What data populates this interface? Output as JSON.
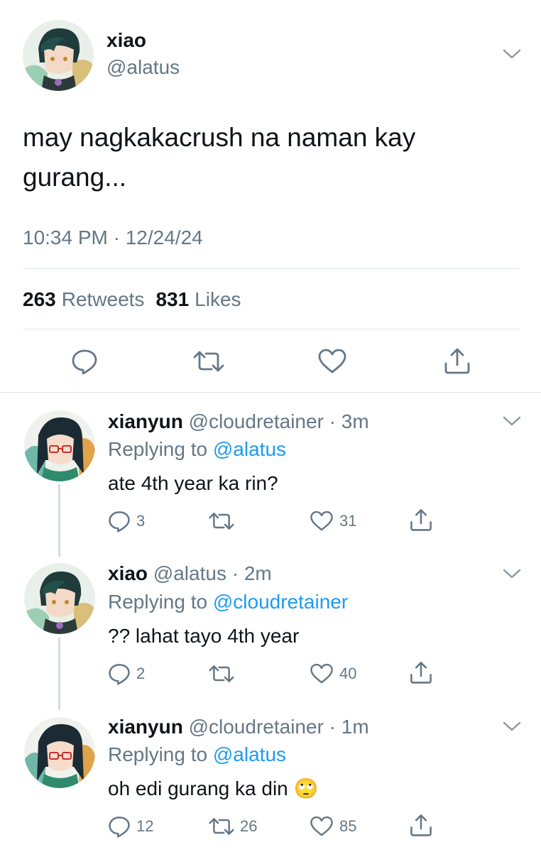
{
  "main_tweet": {
    "display_name": "xiao",
    "handle": "@alatus",
    "text_line1": "may nagkakacrush na naman kay",
    "text_line2": "gurang...",
    "timestamp": "10:34 PM · 12/24/24",
    "retweets_count": "263",
    "retweets_label": "Retweets",
    "likes_count": "831",
    "likes_label": "Likes",
    "menu_icon": "chevron-down-icon",
    "actions": [
      "reply-icon",
      "retweet-icon",
      "like-icon",
      "share-icon"
    ]
  },
  "replies": [
    {
      "display_name": "xianyun",
      "handle_time": "@cloudretainer · 3m",
      "replying_prefix": "Replying to",
      "replying_to": "@alatus",
      "text": "ate 4th year ka rin?",
      "reply_count": "3",
      "retweet_count": "",
      "like_count": "31"
    },
    {
      "display_name": "xiao",
      "handle_time": "@alatus · 2m",
      "replying_prefix": "Replying to",
      "replying_to": "@cloudretainer",
      "text": "?? lahat tayo 4th year",
      "reply_count": "2",
      "retweet_count": "",
      "like_count": "40"
    },
    {
      "display_name": "xianyun",
      "handle_time": "@cloudretainer · 1m",
      "replying_prefix": "Replying to",
      "replying_to": "@alatus",
      "text": "oh edi gurang ka din",
      "emoji": "🙄",
      "reply_count": "12",
      "retweet_count": "26",
      "like_count": "85"
    }
  ],
  "colors": {
    "text": "#0f1419",
    "muted": "#657786",
    "link": "#1d9bf0",
    "divider": "#e1e8ed"
  }
}
